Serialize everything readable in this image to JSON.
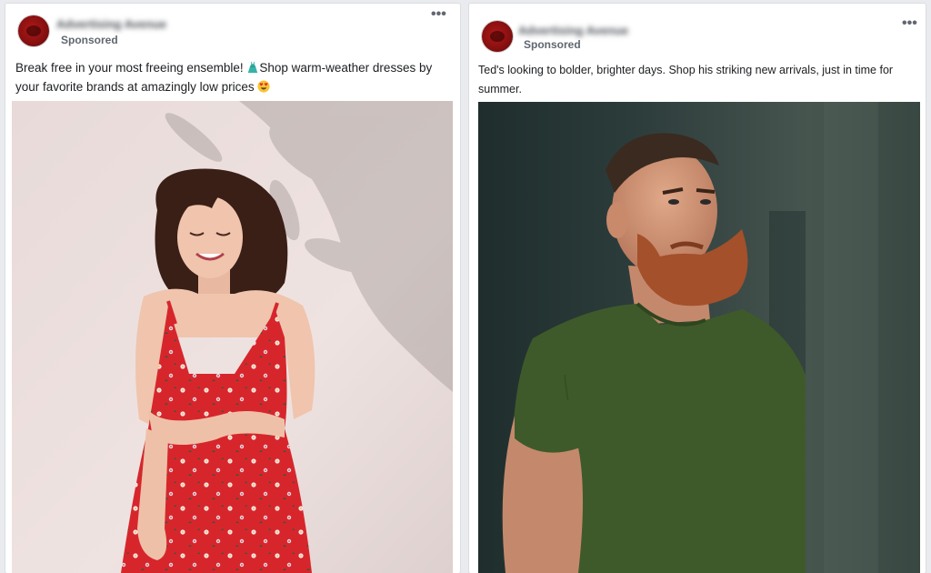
{
  "posts": [
    {
      "page_name": "Advertising Avenue",
      "sponsored_label": "Sponsored",
      "caption_part1": "Break free in your most freeing ensemble! ",
      "caption_part2": "Shop warm-weather dresses by your favorite brands at amazingly low prices ",
      "inline_icons": [
        "dress-icon",
        "heart-eyes-emoji"
      ],
      "image": "woman-red-floral-dress-photo"
    },
    {
      "page_name": "Advertising Avenue",
      "sponsored_label": "Sponsored",
      "caption": "Ted's looking to bolder, brighter days. Shop his striking new arrivals, just in time for summer.",
      "image": "bearded-man-green-tshirt-photo"
    }
  ],
  "more_icon_label": "•••",
  "colors": {
    "background": "#e9ebee",
    "card": "#ffffff",
    "text": "#1c1e21",
    "secondary_text": "#606770",
    "dress_red": "#d42a2a",
    "shirt_green": "#3f5a2a"
  }
}
